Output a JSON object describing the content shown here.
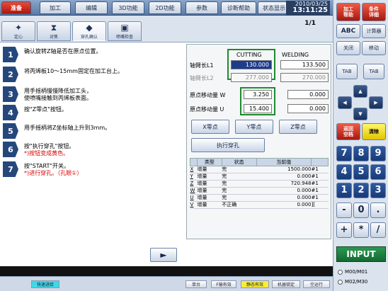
{
  "top_tabs": [
    {
      "label": "准备",
      "active": true
    },
    {
      "label": "加工",
      "active": false
    },
    {
      "label": "编辑",
      "active": false
    },
    {
      "label": "3D功能",
      "active": false
    },
    {
      "label": "2D功能",
      "active": false
    },
    {
      "label": "参数",
      "active": false
    },
    {
      "label": "诊断帮助",
      "active": false
    },
    {
      "label": "状态显示",
      "active": false
    }
  ],
  "datetime": {
    "date": "2010/03/25",
    "time": "13:11:25"
  },
  "sub_tabs": [
    {
      "label": "定心",
      "icon": "✦"
    },
    {
      "label": "对焦",
      "icon": "⧗"
    },
    {
      "label": "穿孔确认",
      "icon": "◆"
    },
    {
      "label": "喷嘴检查",
      "icon": "▣"
    }
  ],
  "page_indicator": "1/1",
  "steps": [
    {
      "num": "1",
      "lines": [
        "确认旋转Z轴是否在原点位置。"
      ],
      "red": []
    },
    {
      "num": "2",
      "lines": [
        "将丙烯板10～15mm固定在加工台上。"
      ],
      "red": []
    },
    {
      "num": "3",
      "lines": [
        "用手摇柄慢慢降低加工头，",
        "使喷嘴接触到丙烯板表面。"
      ],
      "red": []
    },
    {
      "num": "4",
      "lines": [
        "按\"Z零点\"按钮。"
      ],
      "red": []
    },
    {
      "num": "5",
      "lines": [
        "用手摇柄将Z坐标轴上升到3mm。"
      ],
      "red": []
    },
    {
      "num": "6",
      "lines": [
        "按\"执行穿孔\"按钮。"
      ],
      "red": [
        "*)按钮变成黄色。"
      ]
    },
    {
      "num": "7",
      "lines": [
        "按\"START\"开关。"
      ],
      "red": [
        "*)进行穿孔。（孔眼①）"
      ]
    }
  ],
  "data_panel": {
    "col_cutting": "CUTTING",
    "col_welding": "WELDING",
    "rows": [
      {
        "label": "轴臂长L1",
        "cutting": "130.000",
        "welding": "133.500"
      },
      {
        "label": "轴臂长L2",
        "cutting": "277.000",
        "welding": "270.000"
      },
      {
        "label": "原点移动量  W",
        "cutting": "3.250",
        "welding": "0.000"
      },
      {
        "label": "原点移动量  U",
        "cutting": "15.400",
        "welding": "0.000"
      }
    ],
    "btn_x_zero": "X零点",
    "btn_y_zero": "Y零点",
    "btn_z_zero": "Z零点",
    "btn_execute": "执行穿孔",
    "table_headers": [
      "类型",
      "状态",
      "当前值"
    ],
    "table_rows": [
      {
        "axis": "X",
        "type": "增量",
        "state": "完",
        "value": "1500.000",
        "suffix": "#1"
      },
      {
        "axis": "Y",
        "type": "增量",
        "state": "完",
        "value": "0.000",
        "suffix": "#1"
      },
      {
        "axis": "Z",
        "type": "增量",
        "state": "完",
        "value": "720.948",
        "suffix": "#1"
      },
      {
        "axis": "W",
        "type": "增量",
        "state": "完",
        "value": "0.000",
        "suffix": "#1"
      },
      {
        "axis": "U",
        "type": "增量",
        "state": "完",
        "value": "0.000",
        "suffix": "#1"
      },
      {
        "axis": "V",
        "type": "增量",
        "state": "不正确",
        "value": "0.000",
        "suffix": "]["
      }
    ]
  },
  "play_button": "►",
  "keypanel": {
    "machining_help": "加工\n帮助",
    "condition_table": "条件\n详细",
    "abc": "ABC",
    "calculator": "计算器",
    "close": "关闭",
    "move": "移动",
    "tab_left": "TAB",
    "tab_right": "TAB",
    "return_space": "返回\n空档",
    "delete": "清除",
    "numpad": [
      "7",
      "8",
      "9",
      "4",
      "5",
      "6",
      "1",
      "2",
      "3",
      "-",
      "0",
      ".",
      "+",
      "*",
      "/"
    ],
    "input": "INPUT",
    "mode1": "M00/M01",
    "mode2": "M02/M30"
  },
  "bottom_buttons": [
    {
      "label": "快速进给",
      "style": "cyan"
    },
    {
      "label": "单台",
      "style": "plain"
    },
    {
      "label": "F输有效",
      "style": "plain"
    },
    {
      "label": "静态有效",
      "style": "yellow"
    },
    {
      "label": "机器锁定",
      "style": "plain"
    },
    {
      "label": "空运行",
      "style": "plain"
    }
  ],
  "colors": {
    "accent_red": "#c4170c",
    "navy": "#24477c",
    "highlight_green": "#1f8a2f",
    "input_green": "#1f8a44"
  }
}
